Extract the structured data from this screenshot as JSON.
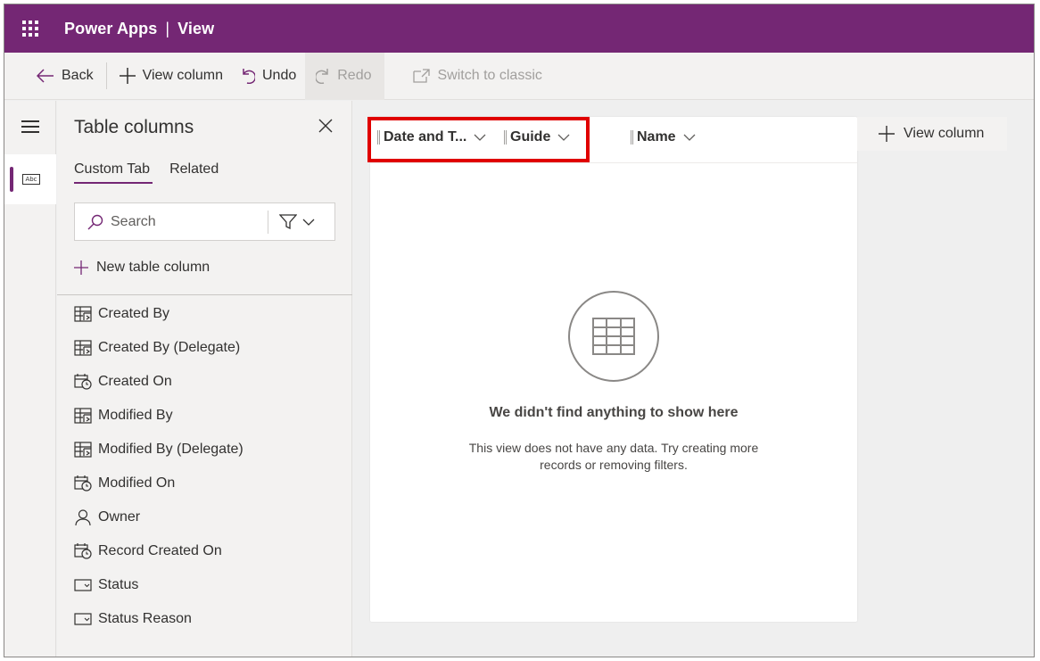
{
  "header": {
    "app_name": "Power Apps",
    "separator": "|",
    "page": "View"
  },
  "commandbar": {
    "back": "Back",
    "view_column": "View column",
    "undo": "Undo",
    "redo": "Redo",
    "switch_classic": "Switch to classic"
  },
  "panel": {
    "title": "Table columns",
    "tabs": [
      "Custom Tab",
      "Related"
    ],
    "search_placeholder": "Search",
    "new_column": "New table column",
    "columns": [
      {
        "label": "Created By",
        "icon": "lookup-icon"
      },
      {
        "label": "Created By (Delegate)",
        "icon": "lookup-icon"
      },
      {
        "label": "Created On",
        "icon": "datetime-icon"
      },
      {
        "label": "Modified By",
        "icon": "lookup-icon"
      },
      {
        "label": "Modified By (Delegate)",
        "icon": "lookup-icon"
      },
      {
        "label": "Modified On",
        "icon": "datetime-icon"
      },
      {
        "label": "Owner",
        "icon": "person-icon"
      },
      {
        "label": "Record Created On",
        "icon": "datetime-icon"
      },
      {
        "label": "Status",
        "icon": "choice-icon"
      },
      {
        "label": "Status Reason",
        "icon": "choice-icon"
      }
    ]
  },
  "grid": {
    "columns": [
      "Date and T...",
      "Guide",
      "Name"
    ],
    "add_column": "View column",
    "empty_title": "We didn't find anything to show here",
    "empty_text": "This view does not have any data. Try creating more records or removing filters."
  },
  "colors": {
    "brand": "#742774",
    "highlight": "#e00000"
  }
}
